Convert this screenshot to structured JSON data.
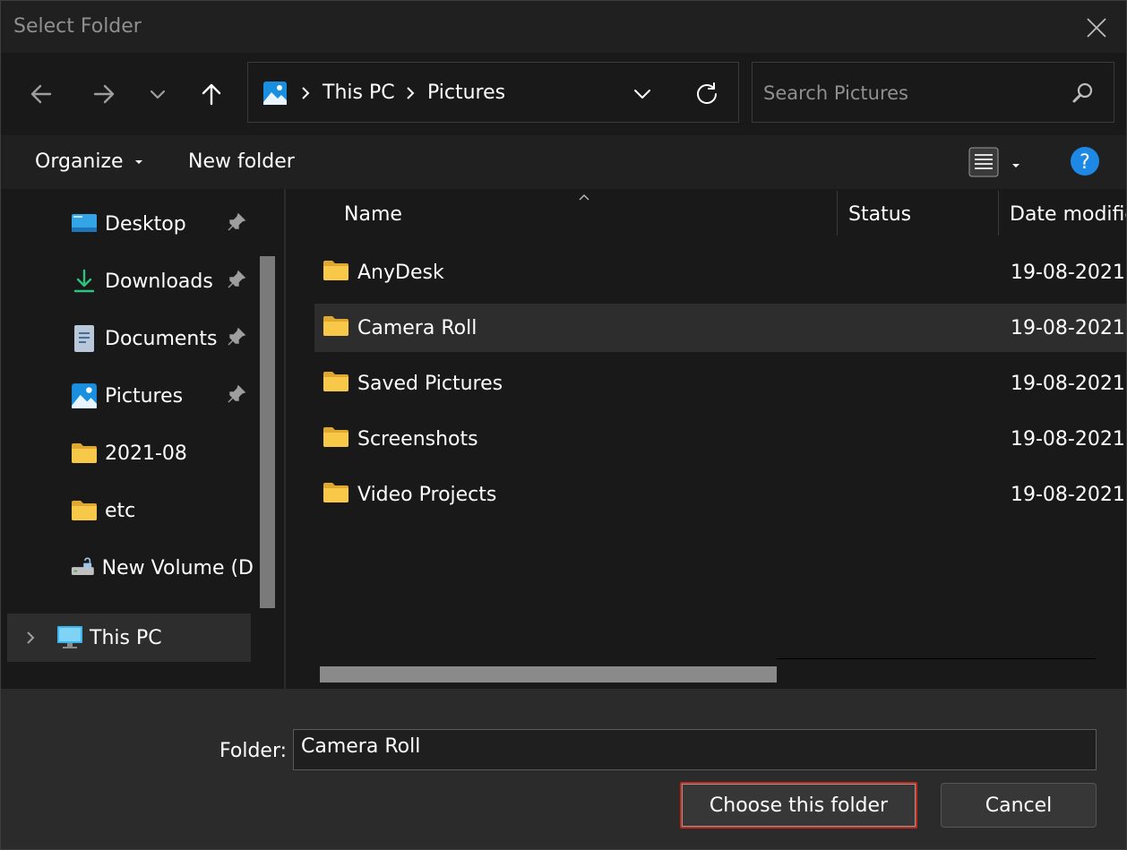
{
  "window": {
    "title": "Select Folder"
  },
  "nav": {
    "back_icon": "arrow-left-icon",
    "forward_icon": "arrow-right-icon",
    "recent_icon": "chevron-down-icon",
    "up_icon": "arrow-up-icon",
    "breadcrumb": [
      "This PC",
      "Pictures"
    ],
    "refresh_icon": "refresh-icon"
  },
  "search": {
    "placeholder": "Search Pictures"
  },
  "toolbar": {
    "organize_label": "Organize",
    "new_folder_label": "New folder"
  },
  "sidebar": {
    "items": [
      {
        "label": "Desktop",
        "icon": "desktop-icon",
        "pinned": true
      },
      {
        "label": "Downloads",
        "icon": "download-icon",
        "pinned": true
      },
      {
        "label": "Documents",
        "icon": "document-icon",
        "pinned": true
      },
      {
        "label": "Pictures",
        "icon": "pictures-icon",
        "pinned": true
      },
      {
        "label": "2021-08",
        "icon": "folder-icon",
        "pinned": false
      },
      {
        "label": "etc",
        "icon": "folder-icon",
        "pinned": false
      },
      {
        "label": "New Volume (D",
        "icon": "drive-icon",
        "pinned": false
      }
    ],
    "this_pc_label": "This PC"
  },
  "columns": [
    "Name",
    "Status",
    "Date modifie"
  ],
  "files": [
    {
      "name": "AnyDesk",
      "date": "19-08-2021"
    },
    {
      "name": "Camera Roll",
      "date": "19-08-2021",
      "selected": true
    },
    {
      "name": "Saved Pictures",
      "date": "19-08-2021"
    },
    {
      "name": "Screenshots",
      "date": "19-08-2021"
    },
    {
      "name": "Video Projects",
      "date": "19-08-2021"
    }
  ],
  "footer": {
    "folder_label": "Folder:",
    "folder_value": "Camera Roll",
    "choose_label": "Choose this folder",
    "cancel_label": "Cancel"
  },
  "colors": {
    "background": "#202020",
    "pane": "#191919",
    "footer": "#2b2b2b",
    "selection": "#2d2d2d",
    "folder": "#f8c948",
    "accent_red": "#c42b1c",
    "help_blue": "#1e88e5"
  }
}
